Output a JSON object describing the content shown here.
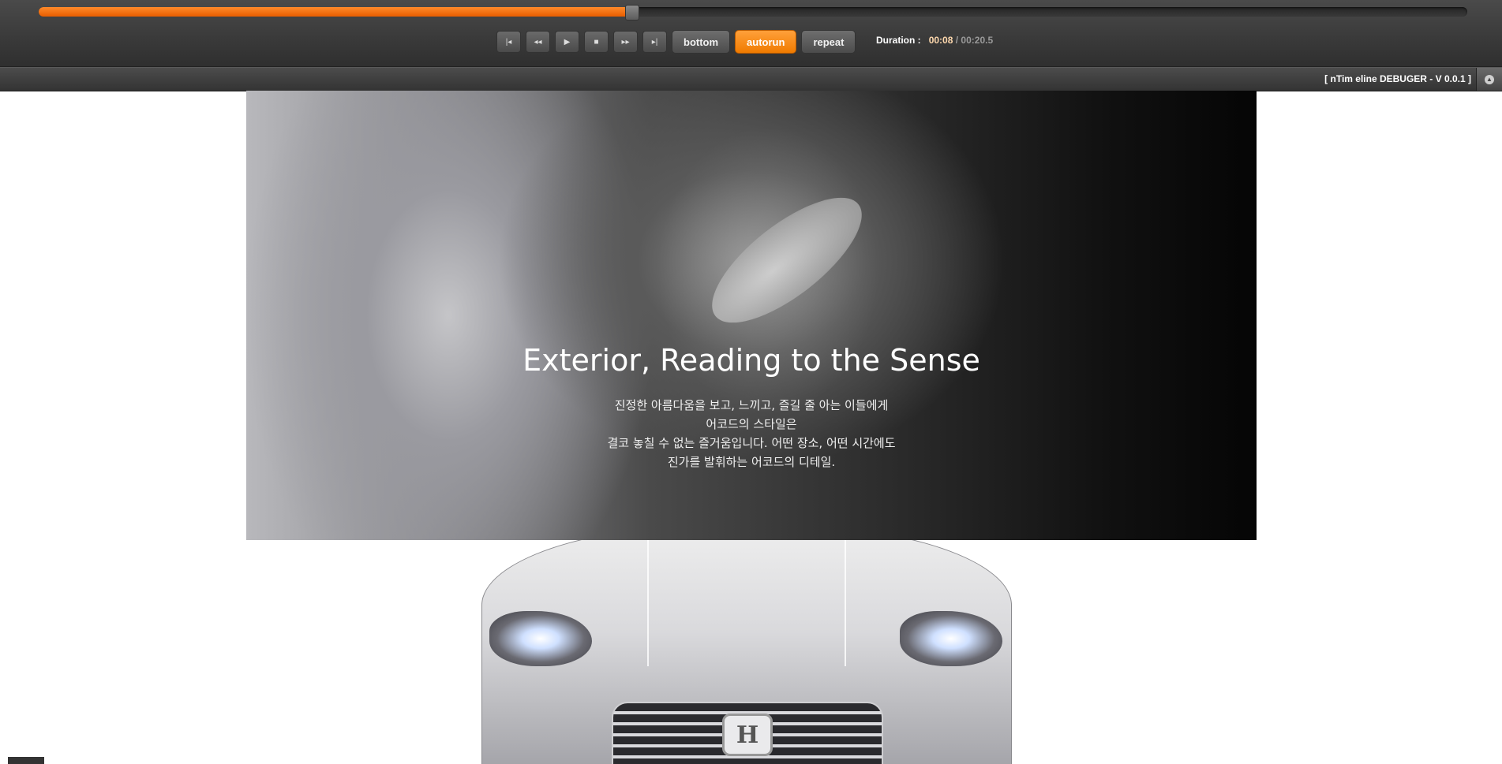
{
  "timeline": {
    "progress": 0.415,
    "fill_color": "#f07000"
  },
  "controls": {
    "buttons": [
      {
        "name": "first-frame-button",
        "icon": "skip-to-start-icon",
        "glyph": "|◂"
      },
      {
        "name": "rewind-button",
        "icon": "rewind-icon",
        "glyph": "◂◂"
      },
      {
        "name": "play-button",
        "icon": "play-icon",
        "glyph": "▶"
      },
      {
        "name": "stop-button",
        "icon": "stop-icon",
        "glyph": "■"
      },
      {
        "name": "fast-forward-button",
        "icon": "fast-forward-icon",
        "glyph": "▸▸"
      },
      {
        "name": "last-frame-button",
        "icon": "skip-to-end-icon",
        "glyph": "▸|"
      }
    ],
    "bottom_label": "bottom",
    "autorun_label": "autorun",
    "repeat_label": "repeat",
    "active_toggle": "autorun",
    "accent_color": "#f58a1f"
  },
  "duration": {
    "label": "Duration :",
    "current": "00:08",
    "separator": "/",
    "total": "00:20.5"
  },
  "debugger": {
    "title": "[ nTim eline DEBUGER - V 0.0.1 ]",
    "collapse_icon": "collapse-icon"
  },
  "hero": {
    "title": "Exterior, Reading to the Sense",
    "lines": [
      "진정한 아름다움을 보고, 느끼고, 즐길 줄 아는 이들에게",
      "어코드의 스타일은",
      "결코 놓칠 수 없는 즐거움입니다. 어떤 장소, 어떤 시간에도",
      "진가를 발휘하는 어코드의 디테일."
    ]
  },
  "car": {
    "emblem_text": "H"
  }
}
